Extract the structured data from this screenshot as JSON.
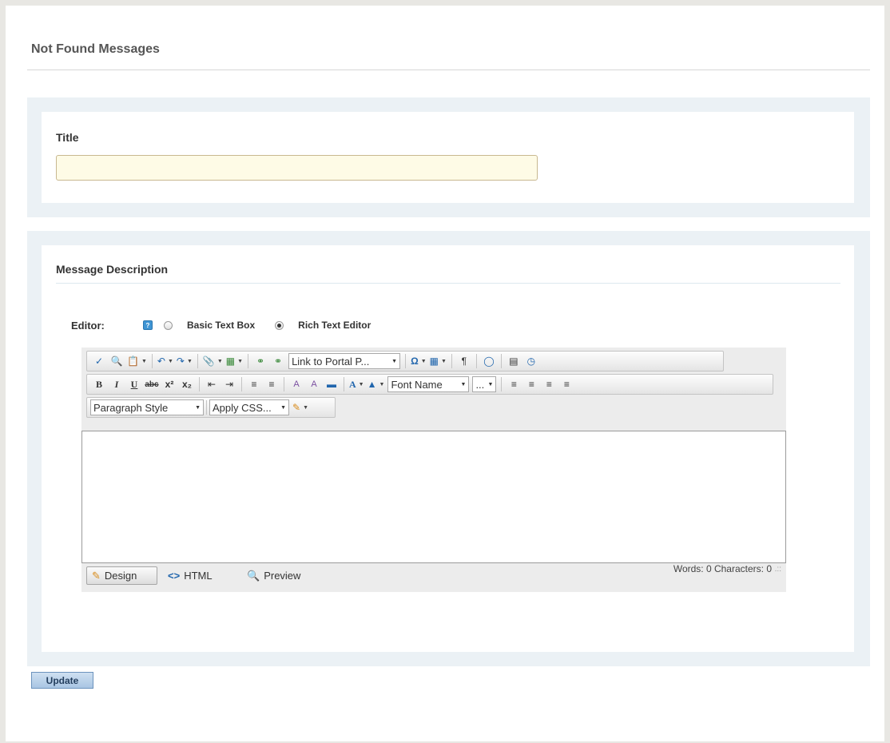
{
  "page": {
    "title": "Not Found Messages"
  },
  "title_section": {
    "label": "Title",
    "input_value": "",
    "input_placeholder": ""
  },
  "description_section": {
    "label": "Message Description"
  },
  "editor_mode": {
    "label": "Editor:",
    "options": [
      {
        "label": "Basic Text Box",
        "selected": false
      },
      {
        "label": "Rich Text Editor",
        "selected": true
      }
    ]
  },
  "toolbar": {
    "link_dropdown": "Link to Portal P...",
    "font_name": "Font Name",
    "font_size": "...",
    "paragraph_style": "Paragraph Style",
    "apply_css": "Apply CSS..."
  },
  "editor_modes": {
    "design": "Design",
    "html": "HTML",
    "preview": "Preview"
  },
  "counter": {
    "text": "Words: 0   Characters: 0"
  },
  "actions": {
    "update": "Update"
  },
  "colors": {
    "panel_bg": "#ebf1f5",
    "page_bg": "#e8e7e3",
    "input_bg": "#fefbe6"
  }
}
